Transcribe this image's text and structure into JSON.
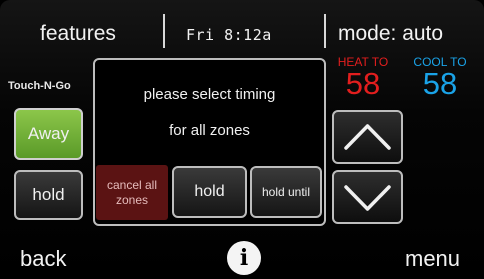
{
  "topbar": {
    "features_label": "features",
    "date_time": "Fri 8:12a",
    "mode_label": "mode: auto"
  },
  "setpoints": {
    "heat_label": "HEAT TO",
    "heat_value": "58",
    "cool_label": "COOL TO",
    "cool_value": "58",
    "heat_color": "#e21e1e",
    "cool_color": "#1aa3e8"
  },
  "brand": "Touch-N-Go",
  "left_buttons": {
    "away_label": "Away",
    "hold_label": "hold",
    "away_color": "#6fb23a"
  },
  "dialog": {
    "line1": "please select timing",
    "line2": "for all zones",
    "cancel_label": "cancel all zones",
    "hold_label": "hold",
    "hold_until_label": "hold until",
    "cancel_color": "#5b1313"
  },
  "arrows": {
    "up_icon": "chevron-up-icon",
    "down_icon": "chevron-down-icon"
  },
  "bottom": {
    "back_label": "back",
    "info_label": "i",
    "menu_label": "menu"
  }
}
